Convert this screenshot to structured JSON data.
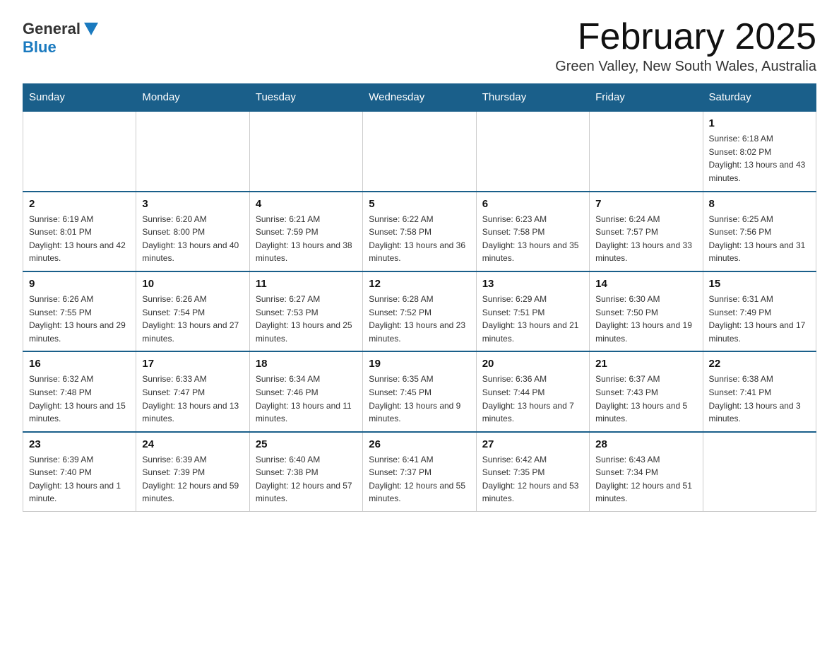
{
  "header": {
    "logo_general": "General",
    "logo_blue": "Blue",
    "month_title": "February 2025",
    "location": "Green Valley, New South Wales, Australia"
  },
  "calendar": {
    "days_of_week": [
      "Sunday",
      "Monday",
      "Tuesday",
      "Wednesday",
      "Thursday",
      "Friday",
      "Saturday"
    ],
    "weeks": [
      [
        {
          "day": "",
          "info": ""
        },
        {
          "day": "",
          "info": ""
        },
        {
          "day": "",
          "info": ""
        },
        {
          "day": "",
          "info": ""
        },
        {
          "day": "",
          "info": ""
        },
        {
          "day": "",
          "info": ""
        },
        {
          "day": "1",
          "info": "Sunrise: 6:18 AM\nSunset: 8:02 PM\nDaylight: 13 hours and 43 minutes."
        }
      ],
      [
        {
          "day": "2",
          "info": "Sunrise: 6:19 AM\nSunset: 8:01 PM\nDaylight: 13 hours and 42 minutes."
        },
        {
          "day": "3",
          "info": "Sunrise: 6:20 AM\nSunset: 8:00 PM\nDaylight: 13 hours and 40 minutes."
        },
        {
          "day": "4",
          "info": "Sunrise: 6:21 AM\nSunset: 7:59 PM\nDaylight: 13 hours and 38 minutes."
        },
        {
          "day": "5",
          "info": "Sunrise: 6:22 AM\nSunset: 7:58 PM\nDaylight: 13 hours and 36 minutes."
        },
        {
          "day": "6",
          "info": "Sunrise: 6:23 AM\nSunset: 7:58 PM\nDaylight: 13 hours and 35 minutes."
        },
        {
          "day": "7",
          "info": "Sunrise: 6:24 AM\nSunset: 7:57 PM\nDaylight: 13 hours and 33 minutes."
        },
        {
          "day": "8",
          "info": "Sunrise: 6:25 AM\nSunset: 7:56 PM\nDaylight: 13 hours and 31 minutes."
        }
      ],
      [
        {
          "day": "9",
          "info": "Sunrise: 6:26 AM\nSunset: 7:55 PM\nDaylight: 13 hours and 29 minutes."
        },
        {
          "day": "10",
          "info": "Sunrise: 6:26 AM\nSunset: 7:54 PM\nDaylight: 13 hours and 27 minutes."
        },
        {
          "day": "11",
          "info": "Sunrise: 6:27 AM\nSunset: 7:53 PM\nDaylight: 13 hours and 25 minutes."
        },
        {
          "day": "12",
          "info": "Sunrise: 6:28 AM\nSunset: 7:52 PM\nDaylight: 13 hours and 23 minutes."
        },
        {
          "day": "13",
          "info": "Sunrise: 6:29 AM\nSunset: 7:51 PM\nDaylight: 13 hours and 21 minutes."
        },
        {
          "day": "14",
          "info": "Sunrise: 6:30 AM\nSunset: 7:50 PM\nDaylight: 13 hours and 19 minutes."
        },
        {
          "day": "15",
          "info": "Sunrise: 6:31 AM\nSunset: 7:49 PM\nDaylight: 13 hours and 17 minutes."
        }
      ],
      [
        {
          "day": "16",
          "info": "Sunrise: 6:32 AM\nSunset: 7:48 PM\nDaylight: 13 hours and 15 minutes."
        },
        {
          "day": "17",
          "info": "Sunrise: 6:33 AM\nSunset: 7:47 PM\nDaylight: 13 hours and 13 minutes."
        },
        {
          "day": "18",
          "info": "Sunrise: 6:34 AM\nSunset: 7:46 PM\nDaylight: 13 hours and 11 minutes."
        },
        {
          "day": "19",
          "info": "Sunrise: 6:35 AM\nSunset: 7:45 PM\nDaylight: 13 hours and 9 minutes."
        },
        {
          "day": "20",
          "info": "Sunrise: 6:36 AM\nSunset: 7:44 PM\nDaylight: 13 hours and 7 minutes."
        },
        {
          "day": "21",
          "info": "Sunrise: 6:37 AM\nSunset: 7:43 PM\nDaylight: 13 hours and 5 minutes."
        },
        {
          "day": "22",
          "info": "Sunrise: 6:38 AM\nSunset: 7:41 PM\nDaylight: 13 hours and 3 minutes."
        }
      ],
      [
        {
          "day": "23",
          "info": "Sunrise: 6:39 AM\nSunset: 7:40 PM\nDaylight: 13 hours and 1 minute."
        },
        {
          "day": "24",
          "info": "Sunrise: 6:39 AM\nSunset: 7:39 PM\nDaylight: 12 hours and 59 minutes."
        },
        {
          "day": "25",
          "info": "Sunrise: 6:40 AM\nSunset: 7:38 PM\nDaylight: 12 hours and 57 minutes."
        },
        {
          "day": "26",
          "info": "Sunrise: 6:41 AM\nSunset: 7:37 PM\nDaylight: 12 hours and 55 minutes."
        },
        {
          "day": "27",
          "info": "Sunrise: 6:42 AM\nSunset: 7:35 PM\nDaylight: 12 hours and 53 minutes."
        },
        {
          "day": "28",
          "info": "Sunrise: 6:43 AM\nSunset: 7:34 PM\nDaylight: 12 hours and 51 minutes."
        },
        {
          "day": "",
          "info": ""
        }
      ]
    ]
  }
}
